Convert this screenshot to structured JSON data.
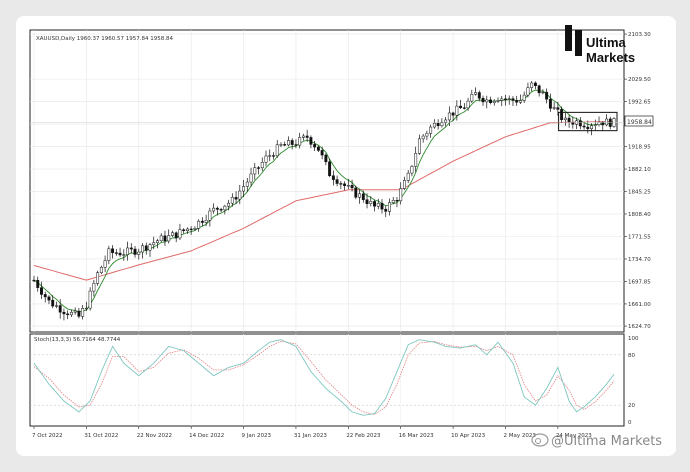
{
  "chart_data": [
    {
      "type": "candlestick",
      "symbol_header": "XAUUSD,Daily  1960.37 1960.57 1957.84 1958.84",
      "current_price_label": "1958.84",
      "y_ticks": [
        "2103.30",
        "2029.50",
        "1992.65",
        "1955.80",
        "1918.95",
        "1882.10",
        "1845.25",
        "1808.40",
        "1771.55",
        "1734.70",
        "1697.85",
        "1661.00",
        "1624.70"
      ],
      "ylim": [
        1615,
        2110
      ],
      "x_ticks": [
        "7 Oct 2022",
        "31 Oct 2022",
        "22 Nov 2022",
        "14 Dec 2022",
        "9 Jan 2023",
        "31 Jan 2023",
        "22 Feb 2023",
        "16 Mar 2023",
        "10 Apr 2023",
        "2 May 2023",
        "24 May 2023"
      ],
      "price_path": [
        [
          0,
          1700
        ],
        [
          4,
          1665
        ],
        [
          8,
          1650
        ],
        [
          12,
          1640
        ],
        [
          14,
          1660
        ],
        [
          17,
          1710
        ],
        [
          20,
          1745
        ],
        [
          24,
          1745
        ],
        [
          28,
          1750
        ],
        [
          33,
          1765
        ],
        [
          38,
          1775
        ],
        [
          43,
          1790
        ],
        [
          48,
          1815
        ],
        [
          53,
          1830
        ],
        [
          58,
          1870
        ],
        [
          62,
          1900
        ],
        [
          66,
          1920
        ],
        [
          70,
          1925
        ],
        [
          73,
          1935
        ],
        [
          76,
          1915
        ],
        [
          79,
          1875
        ],
        [
          82,
          1860
        ],
        [
          85,
          1845
        ],
        [
          88,
          1835
        ],
        [
          91,
          1820
        ],
        [
          94,
          1818
        ],
        [
          97,
          1835
        ],
        [
          100,
          1870
        ],
        [
          103,
          1930
        ],
        [
          106,
          1950
        ],
        [
          109,
          1965
        ],
        [
          112,
          1975
        ],
        [
          115,
          1985
        ],
        [
          118,
          2005
        ],
        [
          121,
          1995
        ],
        [
          124,
          2000
        ],
        [
          127,
          1995
        ],
        [
          130,
          1995
        ],
        [
          133,
          2020
        ],
        [
          136,
          2005
        ],
        [
          139,
          1980
        ],
        [
          142,
          1960
        ],
        [
          145,
          1960
        ],
        [
          148,
          1955
        ],
        [
          151,
          1960
        ],
        [
          155,
          1958
        ]
      ],
      "moving_average": [
        [
          0,
          1724
        ],
        [
          14,
          1700
        ],
        [
          28,
          1725
        ],
        [
          42,
          1748
        ],
        [
          56,
          1785
        ],
        [
          70,
          1830
        ],
        [
          84,
          1848
        ],
        [
          98,
          1848
        ],
        [
          112,
          1895
        ],
        [
          126,
          1935
        ],
        [
          138,
          1958
        ],
        [
          155,
          1960
        ]
      ],
      "n_bars": 156,
      "highlight_box": {
        "x_start_bar": 141,
        "x_end_bar": 155,
        "price_low": 1945,
        "price_high": 1975
      },
      "colors": {
        "candle": "#111111",
        "ma": "#e06a6a",
        "fast_ma": "#2e8b2e"
      }
    },
    {
      "type": "line",
      "indicator_label": "Stoch(13,3,3) 56.7164 48.7744",
      "ylim": [
        0,
        100
      ],
      "y_ticks": [
        "100",
        "80",
        "20",
        "0"
      ],
      "levels": [
        80,
        20
      ],
      "main": [
        [
          0,
          70
        ],
        [
          4,
          45
        ],
        [
          8,
          25
        ],
        [
          12,
          12
        ],
        [
          15,
          25
        ],
        [
          18,
          60
        ],
        [
          21,
          90
        ],
        [
          24,
          70
        ],
        [
          28,
          55
        ],
        [
          32,
          70
        ],
        [
          36,
          90
        ],
        [
          40,
          85
        ],
        [
          44,
          70
        ],
        [
          48,
          55
        ],
        [
          52,
          65
        ],
        [
          56,
          70
        ],
        [
          60,
          85
        ],
        [
          63,
          95
        ],
        [
          66,
          98
        ],
        [
          70,
          90
        ],
        [
          74,
          60
        ],
        [
          78,
          40
        ],
        [
          82,
          25
        ],
        [
          85,
          12
        ],
        [
          88,
          8
        ],
        [
          91,
          10
        ],
        [
          94,
          28
        ],
        [
          97,
          60
        ],
        [
          100,
          92
        ],
        [
          103,
          98
        ],
        [
          107,
          95
        ],
        [
          110,
          90
        ],
        [
          114,
          88
        ],
        [
          118,
          92
        ],
        [
          121,
          80
        ],
        [
          124,
          95
        ],
        [
          128,
          70
        ],
        [
          131,
          30
        ],
        [
          134,
          20
        ],
        [
          137,
          40
        ],
        [
          140,
          65
        ],
        [
          143,
          25
        ],
        [
          145,
          12
        ],
        [
          147,
          18
        ],
        [
          150,
          30
        ],
        [
          153,
          45
        ],
        [
          155,
          57
        ]
      ],
      "signal": [
        [
          0,
          66
        ],
        [
          4,
          52
        ],
        [
          8,
          32
        ],
        [
          12,
          18
        ],
        [
          15,
          20
        ],
        [
          18,
          45
        ],
        [
          21,
          78
        ],
        [
          24,
          78
        ],
        [
          28,
          60
        ],
        [
          32,
          65
        ],
        [
          36,
          82
        ],
        [
          40,
          86
        ],
        [
          44,
          76
        ],
        [
          48,
          62
        ],
        [
          52,
          62
        ],
        [
          56,
          68
        ],
        [
          60,
          80
        ],
        [
          63,
          90
        ],
        [
          66,
          96
        ],
        [
          70,
          93
        ],
        [
          74,
          72
        ],
        [
          78,
          50
        ],
        [
          82,
          33
        ],
        [
          85,
          20
        ],
        [
          88,
          12
        ],
        [
          91,
          9
        ],
        [
          94,
          18
        ],
        [
          97,
          45
        ],
        [
          100,
          80
        ],
        [
          103,
          94
        ],
        [
          107,
          96
        ],
        [
          110,
          92
        ],
        [
          114,
          89
        ],
        [
          118,
          90
        ],
        [
          121,
          85
        ],
        [
          124,
          90
        ],
        [
          128,
          80
        ],
        [
          131,
          45
        ],
        [
          134,
          25
        ],
        [
          137,
          32
        ],
        [
          140,
          55
        ],
        [
          143,
          38
        ],
        [
          145,
          20
        ],
        [
          147,
          15
        ],
        [
          150,
          24
        ],
        [
          153,
          38
        ],
        [
          155,
          49
        ]
      ],
      "colors": {
        "main": "#7fc7c0",
        "signal": "#e08080"
      }
    }
  ],
  "brand": {
    "name_line1": "Ultima",
    "name_line2": "Markets"
  },
  "watermark": "@Ultima Markets",
  "watermark_icon": "weibo-icon"
}
